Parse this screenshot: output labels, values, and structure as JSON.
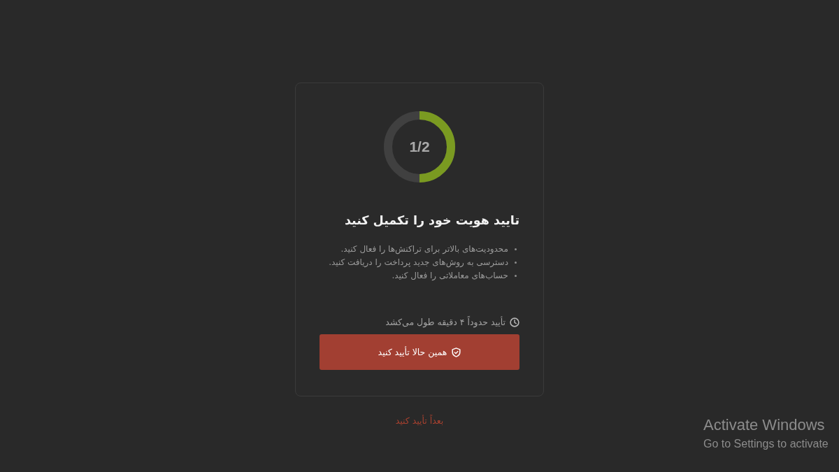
{
  "progress": {
    "label": "1/2",
    "level": 0.5
  },
  "title": "تایید هویت خود را تکمیل کنید",
  "benefits": [
    "محدودیت‌های بالاتر برای تراکنش‌ها را فعال کنید.",
    "دسترسی به روش‌های جدید پرداخت را دریافت کنید.",
    "حساب‌های معاملاتی را فعال کنید."
  ],
  "estimate": "تأیید حدوداً ۴ دقیقه طول می‌کشد",
  "verify_button": "همین حالا تأیید کنید",
  "later_link": "بعداً تأیید کنید",
  "system_notice": {
    "title": "Activate Windows",
    "message": "Go to Settings to activate"
  }
}
